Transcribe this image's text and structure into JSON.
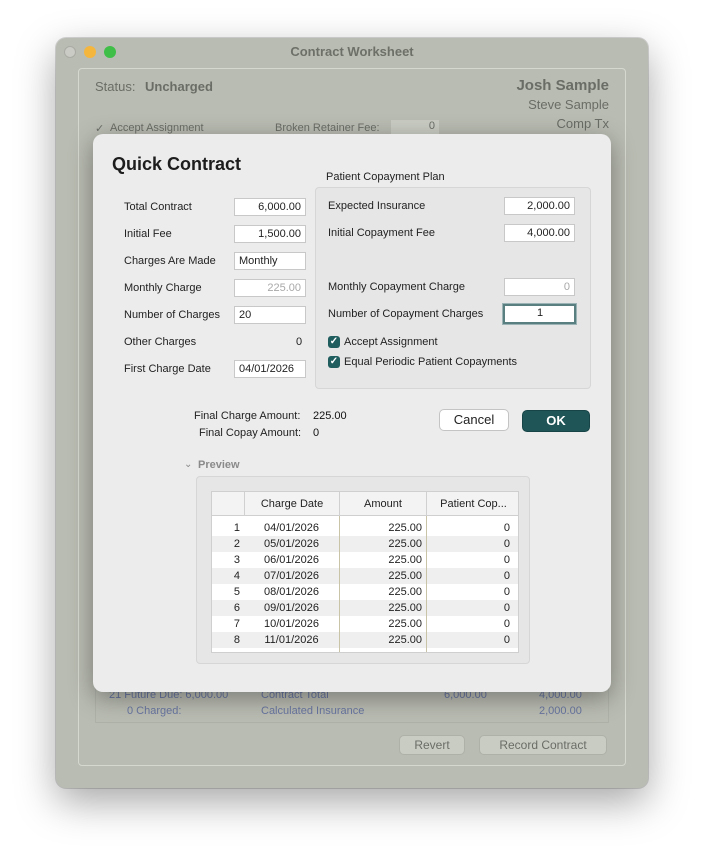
{
  "window": {
    "title": "Contract Worksheet",
    "status_label": "Status:",
    "status_value": "Uncharged",
    "patient_name": "Josh Sample",
    "guarantor_name": "Steve Sample",
    "location": "Comp Tx",
    "accept_assignment_label": "Accept Assignment",
    "broken_retainer_label": "Broken Retainer Fee:",
    "broken_retainer_value": "0",
    "future_due": "21 Future Due:  6,000.00",
    "charged": "0 Charged:",
    "contract_total_label": "Contract Total",
    "contract_total_value": "6,000.00",
    "contract_total_value2": "4,000.00",
    "calc_insurance_label": "Calculated Insurance",
    "calc_insurance_value": "2,000.00",
    "revert_label": "Revert",
    "record_label": "Record Contract"
  },
  "dialog": {
    "title": "Quick Contract",
    "left_fields": {
      "total_contract_label": "Total Contract",
      "total_contract_value": "6,000.00",
      "initial_fee_label": "Initial Fee",
      "initial_fee_value": "1,500.00",
      "charges_made_label": "Charges Are Made",
      "charges_made_value": "Monthly",
      "monthly_charge_label": "Monthly Charge",
      "monthly_charge_value": "225.00",
      "num_charges_label": "Number of Charges",
      "num_charges_value": "20",
      "other_charges_label": "Other Charges",
      "other_charges_value": "0",
      "first_charge_date_label": "First Charge Date",
      "first_charge_date_value": "04/01/2026"
    },
    "copay_plan": {
      "heading": "Patient Copayment Plan",
      "expected_insurance_label": "Expected Insurance",
      "expected_insurance_value": "2,000.00",
      "initial_copay_label": "Initial Copayment Fee",
      "initial_copay_value": "4,000.00",
      "monthly_copay_label": "Monthly Copayment Charge",
      "monthly_copay_value": "0",
      "num_copay_label": "Number of Copayment Charges",
      "num_copay_value": "1",
      "accept_assignment_label": "Accept Assignment",
      "equal_periodic_label": "Equal Periodic Patient Copayments"
    },
    "final_charge_label": "Final Charge Amount:",
    "final_charge_value": "225.00",
    "final_copay_label": "Final Copay Amount:",
    "final_copay_value": "0",
    "cancel_label": "Cancel",
    "ok_label": "OK",
    "preview_label": "Preview",
    "table": {
      "columns": [
        "",
        "Charge Date",
        "Amount",
        "Patient Cop..."
      ],
      "rows": [
        {
          "num": "1",
          "date": "04/01/2026",
          "amount": "225.00",
          "copay": "0"
        },
        {
          "num": "2",
          "date": "05/01/2026",
          "amount": "225.00",
          "copay": "0"
        },
        {
          "num": "3",
          "date": "06/01/2026",
          "amount": "225.00",
          "copay": "0"
        },
        {
          "num": "4",
          "date": "07/01/2026",
          "amount": "225.00",
          "copay": "0"
        },
        {
          "num": "5",
          "date": "08/01/2026",
          "amount": "225.00",
          "copay": "0"
        },
        {
          "num": "6",
          "date": "09/01/2026",
          "amount": "225.00",
          "copay": "0"
        },
        {
          "num": "7",
          "date": "10/01/2026",
          "amount": "225.00",
          "copay": "0"
        },
        {
          "num": "8",
          "date": "11/01/2026",
          "amount": "225.00",
          "copay": "0"
        }
      ]
    }
  },
  "colors": {
    "accent": "#1f5557",
    "window_background": "#b9bcb2",
    "dialog_background": "#ececec"
  }
}
